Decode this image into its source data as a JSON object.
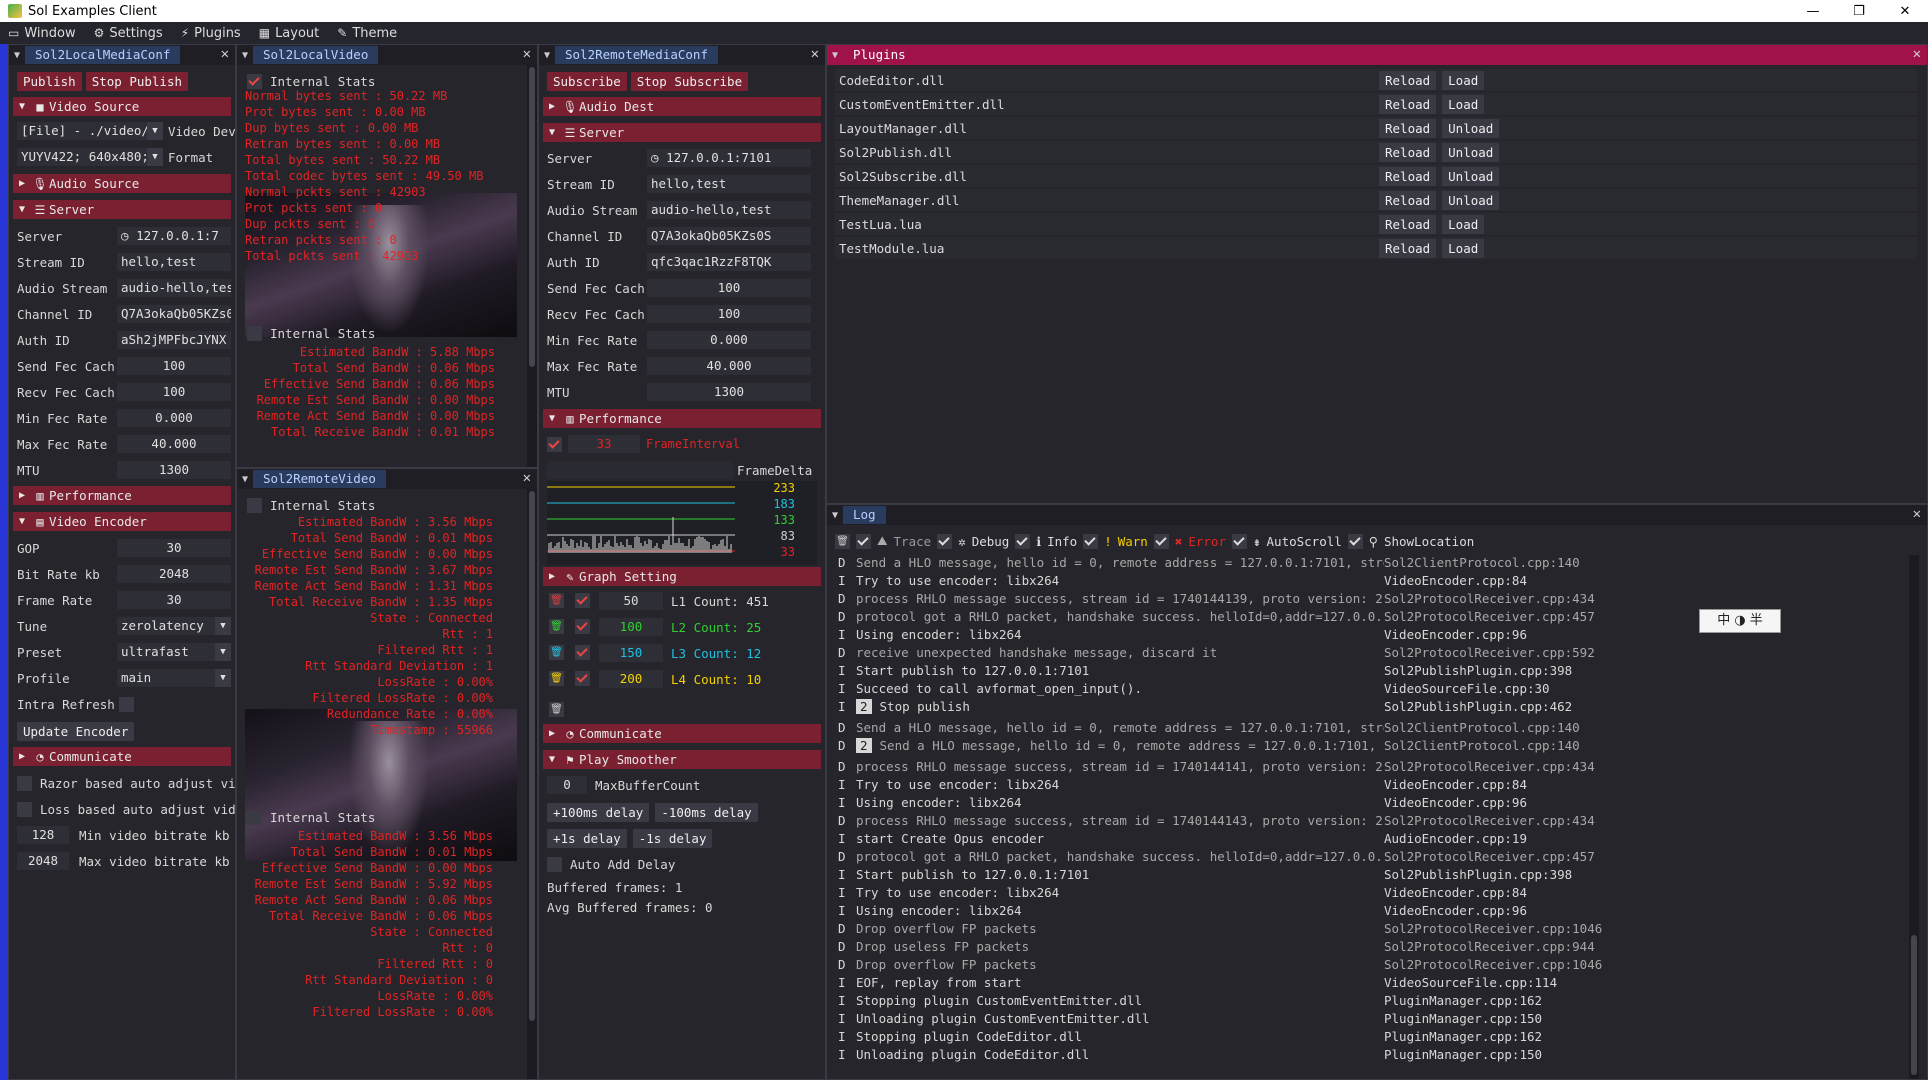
{
  "window": {
    "title": "Sol Examples Client",
    "minimize": "—",
    "restore": "❐",
    "close": "✕"
  },
  "menu": [
    {
      "label": "Window",
      "icon": "window-icon"
    },
    {
      "label": "Settings",
      "icon": "gear-icon"
    },
    {
      "label": "Plugins",
      "icon": "plug-icon"
    },
    {
      "label": "Layout",
      "icon": "layout-icon"
    },
    {
      "label": "Theme",
      "icon": "brush-icon"
    }
  ],
  "local_conf": {
    "title": "Sol2LocalMediaConf",
    "publish": "Publish",
    "stop_publish": "Stop Publish",
    "video_source": "Video Source",
    "file_combo": "[File] - ./video/",
    "video_dev_label": "Video Dev",
    "format_combo": "YUYV422; 640x480;",
    "format_label": "Format",
    "audio_source": "Audio Source",
    "server_sect": "Server",
    "fields": [
      {
        "label": "Server",
        "value": "127.0.0.1:7"
      },
      {
        "label": "Stream ID",
        "value": "hello,test"
      },
      {
        "label": "Audio Stream",
        "value": "audio-hello,tes"
      },
      {
        "label": "Channel ID",
        "value": "Q7A3okaQb05KZs0"
      },
      {
        "label": "Auth ID",
        "value": "aSh2jMPFbcJYNX"
      },
      {
        "label": "Send Fec Cach",
        "value": "100"
      },
      {
        "label": "Recv Fec Cach",
        "value": "100"
      },
      {
        "label": "Min Fec Rate",
        "value": "0.000"
      },
      {
        "label": "Max Fec Rate",
        "value": "40.000"
      },
      {
        "label": "MTU",
        "value": "1300"
      }
    ],
    "performance": "Performance",
    "video_encoder": "Video Encoder",
    "encoder_fields": [
      {
        "label": "GOP",
        "value": "30"
      },
      {
        "label": "Bit Rate kb",
        "value": "2048"
      },
      {
        "label": "Frame Rate",
        "value": "30"
      }
    ],
    "tune_label": "Tune",
    "tune_value": "zerolatency",
    "preset_label": "Preset",
    "preset_value": "ultrafast",
    "profile_label": "Profile",
    "profile_value": "main",
    "intra_refresh": "Intra Refresh",
    "update_encoder": "Update Encoder",
    "communicate": "Communicate",
    "razor": "Razor based auto adjust vic",
    "loss": "Loss based auto adjust vide",
    "min_bitrate_value": "128",
    "min_bitrate_label": "Min video bitrate kb",
    "max_bitrate_value": "2048",
    "max_bitrate_label": "Max video bitrate kb"
  },
  "local_video": {
    "title": "Sol2LocalVideo",
    "internal_stats": "Internal Stats",
    "send_stats": [
      "Normal bytes sent : 50.22 MB",
      "Prot bytes sent : 0.00 MB",
      "Dup bytes sent : 0.00 MB",
      "Retran bytes sent : 0.00 MB",
      "Total bytes sent : 50.22 MB",
      "Total codec bytes sent : 49.50 MB",
      "Normal pckts sent : 42903",
      "Prot pckts sent : 0",
      "Dup pckts sent : 0",
      "Retran pckts sent : 0",
      "Total pckts sent : 42903"
    ],
    "internal_stats2": "Internal Stats",
    "bw_stats": [
      "Estimated BandW : 5.88 Mbps",
      "Total Send BandW : 0.06 Mbps",
      "Effective Send BandW : 0.06 Mbps",
      "Remote Est Send BandW : 0.00 Mbps",
      "Remote Act Send BandW : 0.00 Mbps",
      "Total Receive BandW : 0.01 Mbps"
    ]
  },
  "remote_video": {
    "title": "Sol2RemoteVideo",
    "internal_stats": "Internal Stats",
    "stats": [
      "Estimated BandW : 3.56 Mbps",
      "Total Send BandW : 0.01 Mbps",
      "Effective Send BandW : 0.00 Mbps",
      "Remote Est Send BandW : 3.67 Mbps",
      "Remote Act Send BandW : 1.31 Mbps",
      "Total Receive BandW : 1.35 Mbps",
      "State : Connected",
      "Rtt : 1",
      "Filtered Rtt : 1",
      "Rtt Standard Deviation : 1",
      "LossRate : 0.00%",
      "Filtered LossRate : 0.00%",
      "Redundance Rate : 0.00%",
      "Timestamp : 55966"
    ],
    "internal_stats2": "Internal Stats",
    "stats2": [
      "Estimated BandW : 3.56 Mbps",
      "Total Send BandW : 0.01 Mbps",
      "Effective Send BandW : 0.00 Mbps",
      "Remote Est Send BandW : 5.92 Mbps",
      "Remote Act Send BandW : 0.06 Mbps",
      "Total Receive BandW : 0.06 Mbps",
      "State : Connected",
      "Rtt : 0",
      "Filtered Rtt : 0",
      "Rtt Standard Deviation : 0",
      "LossRate : 0.00%",
      "Filtered LossRate : 0.00%"
    ]
  },
  "remote_conf": {
    "title": "Sol2RemoteMediaConf",
    "subscribe": "Subscribe",
    "stop_subscribe": "Stop Subscribe",
    "audio_dest": "Audio Dest",
    "server_sect": "Server",
    "fields": [
      {
        "label": "Server",
        "value": "127.0.0.1:7101"
      },
      {
        "label": "Stream ID",
        "value": "hello,test"
      },
      {
        "label": "Audio Stream",
        "value": "audio-hello,test"
      },
      {
        "label": "Channel ID",
        "value": "Q7A3okaQb05KZs0S"
      },
      {
        "label": "Auth ID",
        "value": "qfc3qac1RzzF8TQK"
      },
      {
        "label": "Send Fec Cach",
        "value": "100"
      },
      {
        "label": "Recv Fec Cach",
        "value": "100"
      },
      {
        "label": "Min Fec Rate",
        "value": "0.000"
      },
      {
        "label": "Max Fec Rate",
        "value": "40.000"
      },
      {
        "label": "MTU",
        "value": "1300"
      }
    ],
    "performance": "Performance",
    "frame_interval_value": "33",
    "frame_interval_label": "FrameInterval",
    "frame_delta_label": "FrameDelta",
    "graph_levels": [
      {
        "value": "233",
        "color": "#f5d000"
      },
      {
        "value": "183",
        "color": "#20c0e0"
      },
      {
        "value": "133",
        "color": "#30d030"
      },
      {
        "value": "83",
        "color": "#d0d0d0"
      },
      {
        "value": "33",
        "color": "#e02424"
      }
    ],
    "graph_setting": "Graph Setting",
    "graph_rows": [
      {
        "value": "50",
        "name": "L1",
        "count_label": "Count:",
        "count": "451",
        "color": "#d8d8d8",
        "bin": "#e03a3a"
      },
      {
        "value": "100",
        "name": "L2",
        "count_label": "Count:",
        "count": "25",
        "color": "#30d030",
        "bin": "#30d030"
      },
      {
        "value": "150",
        "name": "L3",
        "count_label": "Count:",
        "count": "12",
        "color": "#20c0e0",
        "bin": "#20c0e0"
      },
      {
        "value": "200",
        "name": "L4",
        "count_label": "Count:",
        "count": "10",
        "color": "#f5d000",
        "bin": "#f5d000"
      }
    ],
    "communicate": "Communicate",
    "play_smoother": "Play Smoother",
    "max_buffer_value": "0",
    "max_buffer_label": "MaxBufferCount",
    "plus100": "+100ms delay",
    "minus100": "-100ms delay",
    "plus1s": "+1s delay",
    "minus1s": "-1s delay",
    "auto_add_delay": "Auto Add Delay",
    "buffered": "Buffered frames: 1",
    "avg_buffered": "Avg Buffered frames: 0"
  },
  "plugins": {
    "title": "Plugins",
    "reload": "Reload",
    "items": [
      {
        "name": "CodeEditor.dll",
        "action": "Load"
      },
      {
        "name": "CustomEventEmitter.dll",
        "action": "Load"
      },
      {
        "name": "LayoutManager.dll",
        "action": "Unload"
      },
      {
        "name": "Sol2Publish.dll",
        "action": "Unload"
      },
      {
        "name": "Sol2Subscribe.dll",
        "action": "Unload"
      },
      {
        "name": "ThemeManager.dll",
        "action": "Unload"
      },
      {
        "name": "TestLua.lua",
        "action": "Load"
      },
      {
        "name": "TestModule.lua",
        "action": "Load"
      }
    ]
  },
  "log": {
    "title": "Log",
    "filters": {
      "trace": "Trace",
      "debug": "Debug",
      "info": "Info",
      "warn": "Warn",
      "error": "Error",
      "autoscroll": "AutoScroll",
      "showloc": "ShowLocation"
    },
    "ime": "中 ◑ 半",
    "lines": [
      {
        "lv": "D",
        "msg": "Send a HLO message, hello id = 0, remote address = 127.0.0.1:7101, stream",
        "src": "Sol2ClientProtocol.cpp:140"
      },
      {
        "lv": "I",
        "msg": "Try to use encoder: libx264",
        "src": "VideoEncoder.cpp:84"
      },
      {
        "lv": "D",
        "msg": "process RHLO message success, stream id = 1740144139, proto version: 2, h",
        "src": "Sol2ProtocolReceiver.cpp:434"
      },
      {
        "lv": "D",
        "msg": "protocol got a RHLO packet, handshake success. helloId=0,addr=127.0.0.1:7",
        "src": "Sol2ProtocolReceiver.cpp:457"
      },
      {
        "lv": "I",
        "msg": "Using encoder: libx264",
        "src": "VideoEncoder.cpp:96"
      },
      {
        "lv": "D",
        "msg": "receive unexpected handshake message, discard it",
        "src": "Sol2ProtocolReceiver.cpp:592"
      },
      {
        "lv": "I",
        "msg": "Start publish to 127.0.0.1:7101",
        "src": "Sol2PublishPlugin.cpp:398"
      },
      {
        "lv": "I",
        "msg": "Succeed to call avformat_open_input().",
        "src": "VideoSourceFile.cpp:30"
      },
      {
        "lv": "I",
        "badge": "2",
        "msg": "Stop publish",
        "src": "Sol2PublishPlugin.cpp:462"
      },
      {
        "lv": "D",
        "msg": "Send a HLO message, hello id = 0, remote address = 127.0.0.1:7101, stream",
        "src": "Sol2ClientProtocol.cpp:140"
      },
      {
        "lv": "D",
        "badge": "2",
        "msg": "Send a HLO message, hello id = 0, remote address = 127.0.0.1:7101, str",
        "src": "Sol2ClientProtocol.cpp:140"
      },
      {
        "lv": "D",
        "msg": "process RHLO message success, stream id = 1740144141, proto version: 2, h",
        "src": "Sol2ProtocolReceiver.cpp:434"
      },
      {
        "lv": "I",
        "msg": "Try to use encoder: libx264",
        "src": "VideoEncoder.cpp:84"
      },
      {
        "lv": "I",
        "msg": "Using encoder: libx264",
        "src": "VideoEncoder.cpp:96"
      },
      {
        "lv": "D",
        "msg": "process RHLO message success, stream id = 1740144143, proto version: 2, h",
        "src": "Sol2ProtocolReceiver.cpp:434"
      },
      {
        "lv": "I",
        "msg": "start Create Opus encoder",
        "src": "AudioEncoder.cpp:19"
      },
      {
        "lv": "D",
        "msg": "protocol got a RHLO packet, handshake success. helloId=0,addr=127.0.0.1:7",
        "src": "Sol2ProtocolReceiver.cpp:457"
      },
      {
        "lv": "I",
        "msg": "Start publish to 127.0.0.1:7101",
        "src": "Sol2PublishPlugin.cpp:398"
      },
      {
        "lv": "I",
        "msg": "Try to use encoder: libx264",
        "src": "VideoEncoder.cpp:84"
      },
      {
        "lv": "I",
        "msg": "Using encoder: libx264",
        "src": "VideoEncoder.cpp:96"
      },
      {
        "lv": "D",
        "msg": "Drop overflow FP packets",
        "src": "Sol2ProtocolReceiver.cpp:1046"
      },
      {
        "lv": "D",
        "msg": "Drop useless FP packets",
        "src": "Sol2ProtocolReceiver.cpp:944"
      },
      {
        "lv": "D",
        "msg": "Drop overflow FP packets",
        "src": "Sol2ProtocolReceiver.cpp:1046"
      },
      {
        "lv": "I",
        "msg": "EOF, replay from start",
        "src": "VideoSourceFile.cpp:114"
      },
      {
        "lv": "I",
        "msg": "Stopping plugin CustomEventEmitter.dll",
        "src": "PluginManager.cpp:162"
      },
      {
        "lv": "I",
        "msg": "Unloading plugin CustomEventEmitter.dll",
        "src": "PluginManager.cpp:150"
      },
      {
        "lv": "I",
        "msg": "Stopping plugin CodeEditor.dll",
        "src": "PluginManager.cpp:162"
      },
      {
        "lv": "I",
        "msg": "Unloading plugin CodeEditor.dll",
        "src": "PluginManager.cpp:150"
      }
    ]
  }
}
